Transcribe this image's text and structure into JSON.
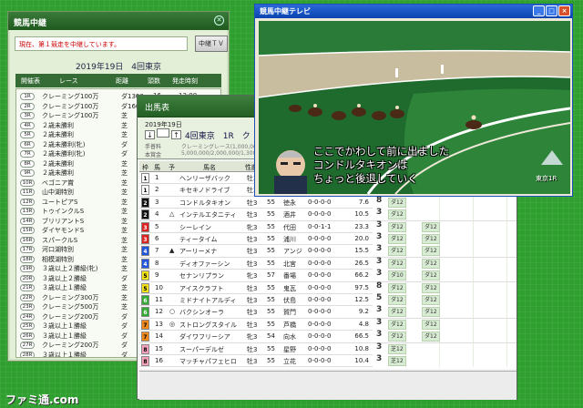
{
  "relay": {
    "title": "競馬中継",
    "status": "現在、第１競走を中継しています。",
    "tv_button": "中継ＴＶ",
    "date": "2019年19日　4回東京",
    "headers": [
      "開催表",
      "レース",
      "距離",
      "頭数",
      "発走時刻"
    ],
    "races": [
      {
        "no": "1R",
        "name": "クレーミング100万",
        "dist": "ダ1300",
        "heads": "16",
        "time": "13:00"
      },
      {
        "no": "2R",
        "name": "クレーミング100万",
        "dist": "ダ1600",
        "heads": "16",
        "time": "13:06"
      },
      {
        "no": "3R",
        "name": "クレーミング100万",
        "dist": "芝",
        "heads": "",
        "time": ""
      },
      {
        "no": "4R",
        "name": "２歳未勝利",
        "dist": "芝",
        "heads": "",
        "time": ""
      },
      {
        "no": "5R",
        "name": "２歳未勝利",
        "dist": "芝",
        "heads": "",
        "time": ""
      },
      {
        "no": "6R",
        "name": "２歳未勝利(牝)",
        "dist": "ダ",
        "heads": "",
        "time": ""
      },
      {
        "no": "7R",
        "name": "２歳未勝利(牝)",
        "dist": "ダ",
        "heads": "",
        "time": ""
      },
      {
        "no": "8R",
        "name": "２歳未勝利",
        "dist": "芝",
        "heads": "",
        "time": ""
      },
      {
        "no": "9R",
        "name": "２歳未勝利",
        "dist": "芝",
        "heads": "",
        "time": ""
      },
      {
        "no": "10R",
        "name": "ベゴニア賞",
        "dist": "芝",
        "heads": "",
        "time": ""
      },
      {
        "no": "11R",
        "name": "山中湖特別",
        "dist": "芝",
        "heads": "",
        "time": ""
      },
      {
        "no": "12R",
        "name": "ユートピアS",
        "dist": "芝",
        "heads": "",
        "time": ""
      },
      {
        "no": "13R",
        "name": "トゥインクルS",
        "dist": "芝",
        "heads": "",
        "time": ""
      },
      {
        "no": "14R",
        "name": "ブリリアントS",
        "dist": "芝",
        "heads": "",
        "time": ""
      },
      {
        "no": "15R",
        "name": "ダイヤモンドS",
        "dist": "芝",
        "heads": "",
        "time": ""
      },
      {
        "no": "16R",
        "name": "スパークルS",
        "dist": "芝",
        "heads": "",
        "time": ""
      },
      {
        "no": "17R",
        "name": "河口湖特別",
        "dist": "芝",
        "heads": "",
        "time": ""
      },
      {
        "no": "18R",
        "name": "相模湖特別",
        "dist": "芝",
        "heads": "",
        "time": ""
      },
      {
        "no": "19R",
        "name": "３歳以上２勝級(牝)",
        "dist": "芝",
        "heads": "",
        "time": ""
      },
      {
        "no": "20R",
        "name": "３歳以上２勝級",
        "dist": "ダ",
        "heads": "",
        "time": ""
      },
      {
        "no": "21R",
        "name": "３歳以上１勝級",
        "dist": "芝",
        "heads": "",
        "time": ""
      },
      {
        "no": "22R",
        "name": "クレーミング300万",
        "dist": "芝",
        "heads": "",
        "time": ""
      },
      {
        "no": "23R",
        "name": "クレーミング500万",
        "dist": "芝",
        "heads": "",
        "time": ""
      },
      {
        "no": "24R",
        "name": "クレーミング200万",
        "dist": "ダ",
        "heads": "",
        "time": ""
      },
      {
        "no": "25R",
        "name": "３歳以上１勝級",
        "dist": "ダ",
        "heads": "",
        "time": ""
      },
      {
        "no": "26R",
        "name": "３歳以上１勝級",
        "dist": "ダ",
        "heads": "",
        "time": ""
      },
      {
        "no": "27R",
        "name": "クレーミング200万",
        "dist": "ダ",
        "heads": "",
        "time": ""
      },
      {
        "no": "28R",
        "name": "３歳以上１勝級",
        "dist": "ダ",
        "heads": "",
        "time": ""
      }
    ]
  },
  "entry": {
    "title": "出馬表",
    "date": "2019年19日",
    "race": "4回東京　1R　ク",
    "info_label1": "手普料",
    "info_label2": "本賞金",
    "info_val1": "クレーミングレース(1,000,000",
    "info_val2": "5,000,000/2,000,000/1,300,000/750",
    "headers": [
      "枠",
      "馬",
      "予",
      "馬名",
      "性齢",
      "斤量",
      "騎手"
    ],
    "horses": [
      {
        "w": "1",
        "wc": "#ffffff",
        "wt": "#000000",
        "n": "1",
        "m": "",
        "name": "ヘンリーザバック",
        "sa": "牡3",
        "kg": "55",
        "j": "木幡",
        "rec": "",
        "odds": "",
        "pk": []
      },
      {
        "w": "1",
        "wc": "#ffffff",
        "wt": "#000000",
        "n": "2",
        "m": "",
        "name": "キセキノドライブ",
        "sa": "牡3",
        "kg": "55",
        "j": "",
        "rec": "",
        "odds": "",
        "pk": []
      },
      {
        "w": "2",
        "wc": "#111111",
        "wt": "#ffffff",
        "n": "3",
        "m": "",
        "name": "コンドルタキオン",
        "sa": "牡3",
        "kg": "55",
        "j": "徳永",
        "rec": "0-0-0-0",
        "odds": "7.6",
        "pk": [
          "8",
          "ダ12"
        ]
      },
      {
        "w": "2",
        "wc": "#111111",
        "wt": "#ffffff",
        "n": "4",
        "m": "△",
        "name": "インテルエタニティ",
        "sa": "牡3",
        "kg": "55",
        "j": "酒井",
        "rec": "0-0-0-0",
        "odds": "10.5",
        "pk": [
          "3",
          "ダ12"
        ]
      },
      {
        "w": "3",
        "wc": "#dd2222",
        "wt": "#ffffff",
        "n": "5",
        "m": "",
        "name": "シーレイン",
        "sa": "牝3",
        "kg": "55",
        "j": "代田",
        "rec": "0-0-1-1",
        "odds": "23.3",
        "pk": [
          "3",
          "ダ12",
          "ダ12"
        ]
      },
      {
        "w": "3",
        "wc": "#dd2222",
        "wt": "#ffffff",
        "n": "6",
        "m": "",
        "name": "ティータイム",
        "sa": "牡3",
        "kg": "55",
        "j": "浦川",
        "rec": "0-0-0-0",
        "odds": "20.0",
        "pk": [
          "3",
          "ダ12",
          "ダ12"
        ]
      },
      {
        "w": "4",
        "wc": "#2255dd",
        "wt": "#ffffff",
        "n": "7",
        "m": "▲",
        "name": "アーリーメナ",
        "sa": "牡3",
        "kg": "55",
        "j": "アンジ",
        "rec": "0-0-0-0",
        "odds": "15.5",
        "pk": [
          "3",
          "ダ12",
          "ダ12"
        ]
      },
      {
        "w": "4",
        "wc": "#2255dd",
        "wt": "#ffffff",
        "n": "8",
        "m": "",
        "name": "ディオファーシン",
        "sa": "牡3",
        "kg": "55",
        "j": "北宮",
        "rec": "0-0-0-0",
        "odds": "26.5",
        "pk": [
          "3",
          "ダ12",
          "ダ12"
        ]
      },
      {
        "w": "5",
        "wc": "#f2e21a",
        "wt": "#000000",
        "n": "9",
        "m": "",
        "name": "セナンリプラン",
        "sa": "牝3",
        "kg": "57",
        "j": "番場",
        "rec": "0-0-0-0",
        "odds": "66.2",
        "pk": [
          "3",
          "ダ10",
          "ダ12"
        ]
      },
      {
        "w": "5",
        "wc": "#f2e21a",
        "wt": "#000000",
        "n": "10",
        "m": "",
        "name": "アイスクラフト",
        "sa": "牡3",
        "kg": "55",
        "j": "鬼瓦",
        "rec": "0-0-0-0",
        "odds": "97.5",
        "pk": [
          "8",
          "ダ12",
          "ダ12"
        ]
      },
      {
        "w": "6",
        "wc": "#33aa33",
        "wt": "#ffffff",
        "n": "11",
        "m": "",
        "name": "ミドナイトアルディ",
        "sa": "牡3",
        "kg": "55",
        "j": "伏島",
        "rec": "0-0-0-0",
        "odds": "12.5",
        "pk": [
          "5",
          "ダ12",
          "ダ12"
        ]
      },
      {
        "w": "6",
        "wc": "#33aa33",
        "wt": "#ffffff",
        "n": "12",
        "m": "○",
        "name": "バクシンオーラ",
        "sa": "牡3",
        "kg": "55",
        "j": "賀門",
        "rec": "0-0-0-0",
        "odds": "9.2",
        "pk": [
          "3",
          "ダ12",
          "ダ12"
        ]
      },
      {
        "w": "7",
        "wc": "#f08a1a",
        "wt": "#000000",
        "n": "13",
        "m": "◎",
        "name": "ストロングスタイル",
        "sa": "牡3",
        "kg": "55",
        "j": "芦橋",
        "rec": "0-0-0-0",
        "odds": "4.8",
        "pk": [
          "3",
          "ダ12",
          "ダ12"
        ]
      },
      {
        "w": "7",
        "wc": "#f08a1a",
        "wt": "#000000",
        "n": "14",
        "m": "",
        "name": "ダイワフリーシア",
        "sa": "牝3",
        "kg": "54",
        "j": "向水",
        "rec": "0-0-0-0",
        "odds": "66.5",
        "pk": [
          "3",
          "ダ12",
          "ダ12"
        ]
      },
      {
        "w": "8",
        "wc": "#f4a0b8",
        "wt": "#000000",
        "n": "15",
        "m": "",
        "name": "スーパーデルゼ",
        "sa": "牡3",
        "kg": "55",
        "j": "星野",
        "rec": "0-0-0-0",
        "odds": "10.8",
        "pk": [
          "3",
          "芝12"
        ]
      },
      {
        "w": "8",
        "wc": "#f4a0b8",
        "wt": "#000000",
        "n": "16",
        "m": "",
        "name": "マッチャパフェヒロ",
        "sa": "牡3",
        "kg": "55",
        "j": "立花",
        "rec": "0-0-0-0",
        "odds": "10.4",
        "pk": [
          "3",
          "芝12"
        ]
      }
    ],
    "footer1": "",
    "footer2": ""
  },
  "tv": {
    "title": "競馬中継テレビ",
    "caption_lines": [
      "ここでかわして前に出ました",
      "コンドルタキオンは",
      "ちょっと後退していく"
    ],
    "logo": "東京1R",
    "window_buttons": [
      "_",
      "□",
      "×"
    ]
  },
  "watermark": "ファミ通.com"
}
